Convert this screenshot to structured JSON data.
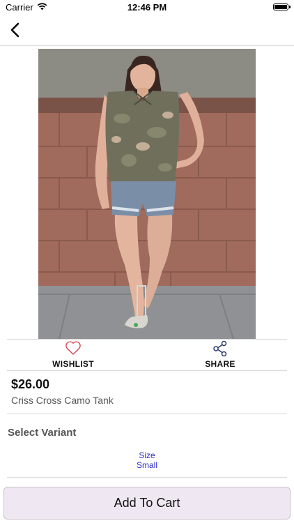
{
  "status_bar": {
    "carrier": "Carrier",
    "time": "12:46 PM",
    "icons": [
      "wifi-icon",
      "battery-icon"
    ]
  },
  "nav": {
    "back_icon": "chevron-left-icon"
  },
  "product": {
    "image_alt": "Woman wearing camo tank and denim shorts",
    "price": "$26.00",
    "name": "Criss Cross Camo Tank"
  },
  "actions": {
    "wishlist_label": "WISHLIST",
    "wishlist_icon": "heart-icon",
    "wishlist_color": "#d83a4a",
    "share_label": "SHARE",
    "share_icon": "share-icon",
    "share_color": "#2a3a6e"
  },
  "variant": {
    "heading": "Select Variant",
    "option_name": "Size",
    "option_value": "Small",
    "link_color": "#2b2bc8"
  },
  "cart": {
    "button_label": "Add To Cart"
  }
}
